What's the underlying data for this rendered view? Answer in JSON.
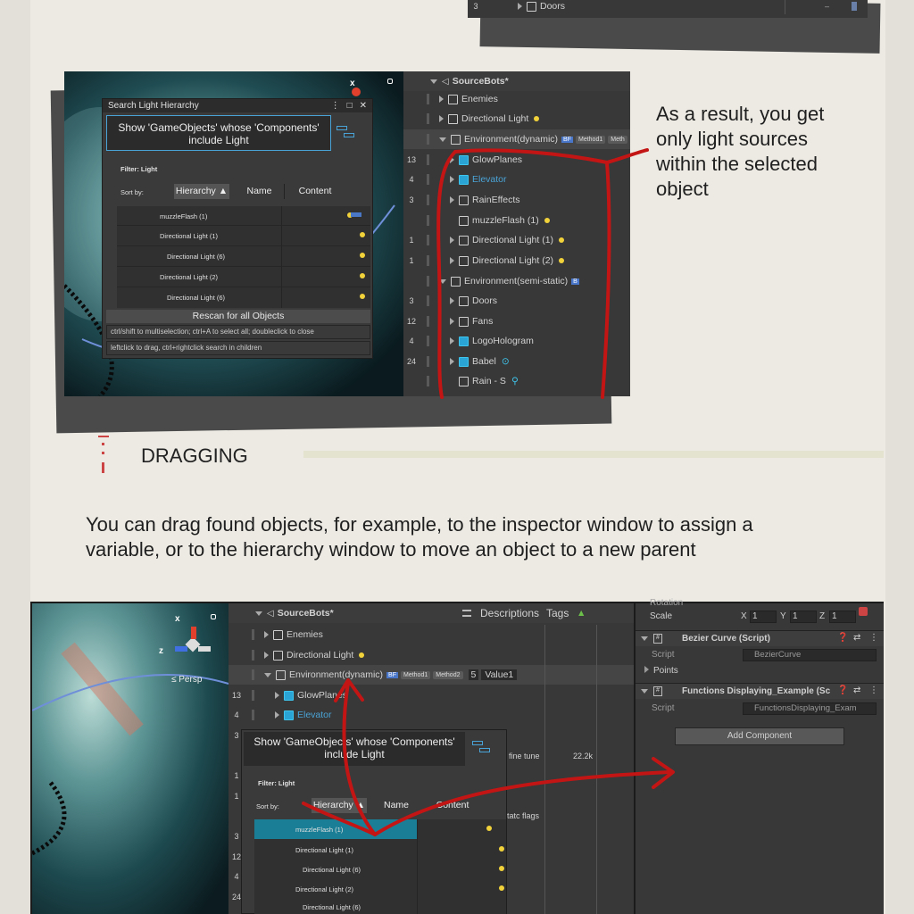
{
  "top_hierarchy_row": {
    "num": "3",
    "label": "Doors"
  },
  "search_popup": {
    "tab_title": "Search Light Hierarchy",
    "query": "Show 'GameObjects' whose 'Components' include Light",
    "filter": "Filter: Light",
    "sort_by": "Sort by:",
    "sort_hierarchy": "Hierarchy ▲",
    "sort_name": "Name",
    "sort_content": "Content",
    "results": [
      "muzzleFlash (1)",
      "Directional Light (1)",
      "Directional Light (6)",
      "Directional Light (2)",
      "Directional Light (6)"
    ],
    "rescan": "Rescan for all Objects",
    "hint1": "ctrl/shift to multiselection; ctrl+A to select all; doubleclick to close",
    "hint2": "leftclick to drag, ctrl+rightclick search in children"
  },
  "hierarchy1": {
    "root": "SourceBots*",
    "rows": [
      {
        "num": "",
        "label": "Enemies"
      },
      {
        "num": "",
        "label": "Directional Light"
      },
      {
        "num": "",
        "label": "Environment(dynamic)"
      },
      {
        "num": "13",
        "label": "GlowPlanes"
      },
      {
        "num": "4",
        "label": "Elevator"
      },
      {
        "num": "3",
        "label": "RainEffects"
      },
      {
        "num": "",
        "label": "muzzleFlash (1)"
      },
      {
        "num": "1",
        "label": "Directional Light (1)"
      },
      {
        "num": "1",
        "label": "Directional Light (2)"
      },
      {
        "num": "",
        "label": "Environment(semi-static)"
      },
      {
        "num": "3",
        "label": "Doors"
      },
      {
        "num": "12",
        "label": "Fans"
      },
      {
        "num": "4",
        "label": "LogoHologram"
      },
      {
        "num": "24",
        "label": "Babel"
      },
      {
        "num": "",
        "label": "Rain - S"
      }
    ],
    "method1": "Method1",
    "method_cut": "Meth"
  },
  "callout": "As a result, you get only light sources within the selected object",
  "section_title": "DRAGGING",
  "section_body": "You can drag found objects, for example, to the inspector window to assign a variable, or to the hierarchy window to move an object to a new parent",
  "scene2": {
    "persp": "≤ Persp",
    "axis_x": "x",
    "axis_z": "z"
  },
  "hierarchy2": {
    "root": "SourceBots*",
    "descriptions": "Descriptions",
    "tags": "Tags",
    "method1": "Method1",
    "method2": "Method2",
    "value_num": "5",
    "value_sel": "Value1",
    "rows": [
      {
        "num": "",
        "label": "Enemies"
      },
      {
        "num": "",
        "label": "Directional Light"
      },
      {
        "num": "",
        "label": "Environment(dynamic)"
      },
      {
        "num": "13",
        "label": "GlowPlanes"
      },
      {
        "num": "4",
        "label": "Elevator"
      },
      {
        "num": "3",
        "label": ""
      },
      {
        "num": "",
        "label": ""
      },
      {
        "num": "1",
        "label": ""
      },
      {
        "num": "1",
        "label": ""
      },
      {
        "num": "",
        "label": ""
      },
      {
        "num": "3",
        "label": ""
      },
      {
        "num": "12",
        "label": ""
      },
      {
        "num": "4",
        "label": ""
      },
      {
        "num": "24",
        "label": ""
      }
    ],
    "fine_tune": "fine tune",
    "fine_val": "22.2k",
    "static_flags": "tatc flags"
  },
  "search_popup2": {
    "query": "Show 'GameObjects' whose 'Components' include Light",
    "filter": "Filter: Light",
    "sort_by": "Sort by:",
    "sort_hierarchy": "Hierarchy ▲",
    "sort_name": "Name",
    "sort_content": "Content",
    "results": [
      "muzzleFlash (1)",
      "Directional Light (1)",
      "Directional Light (6)",
      "Directional Light (2)",
      "Directional Light (6)"
    ]
  },
  "inspector": {
    "rotation": "Rotation",
    "scale": "Scale",
    "scale_x": "1",
    "scale_y": "1",
    "scale_z": "1",
    "comp1_title": "Bezier Curve (Script)",
    "comp1_script_label": "Script",
    "comp1_script_value": "BezierCurve",
    "points": "Points",
    "comp2_title": "Functions Displaying_Example (Sc",
    "comp2_script_label": "Script",
    "comp2_script_value": "FunctionsDisplaying_Exam",
    "add_component": "Add Component"
  },
  "colors": {
    "accent": "#c41515",
    "selection": "#1a7f96",
    "bulb": "#f2d23a"
  }
}
